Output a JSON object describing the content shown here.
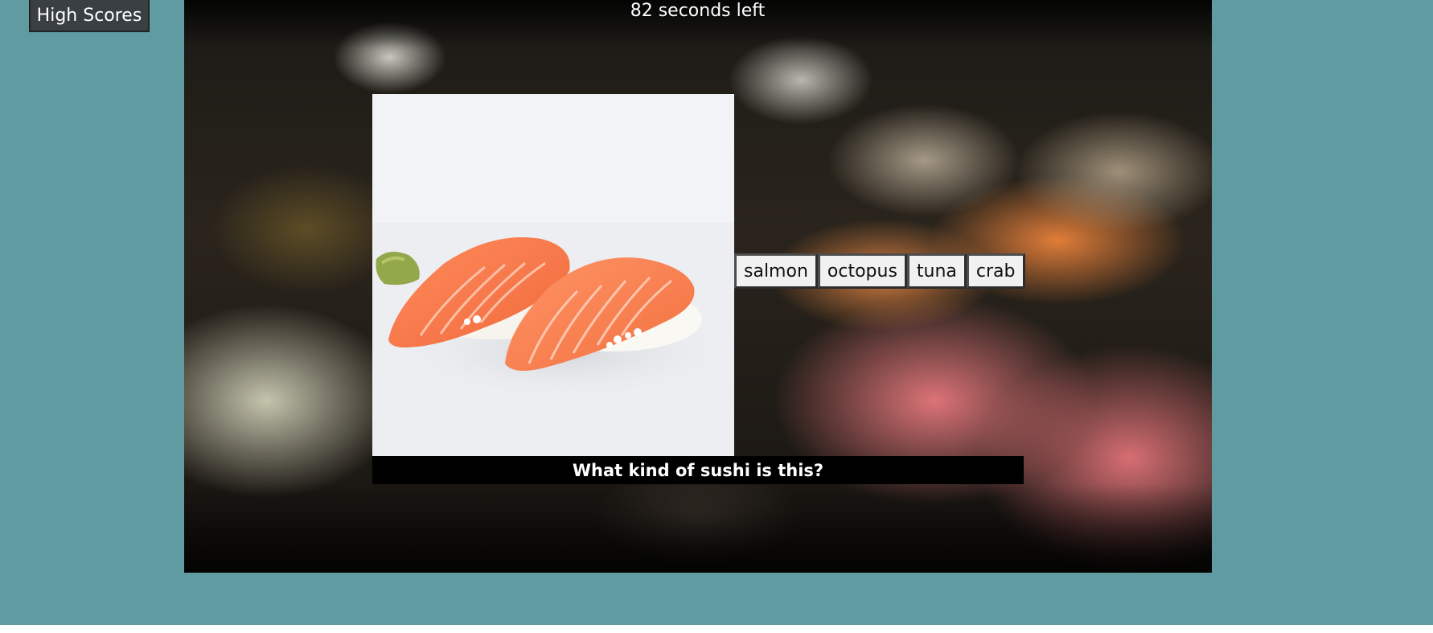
{
  "colors": {
    "page_background": "#5f9ba0",
    "button_dark": "#3a3f44",
    "question_bar": "#000000",
    "answer_button_bg": "#f1f1f1"
  },
  "header": {
    "high_scores_label": "High Scores",
    "timer_text": "82 seconds left"
  },
  "quiz": {
    "photo_icon": "salmon-nigiri-photo",
    "background_icon": "sushi-platter-photo",
    "question": "What kind of sushi is this?",
    "answers": [
      "salmon",
      "octopus",
      "tuna",
      "crab"
    ]
  }
}
